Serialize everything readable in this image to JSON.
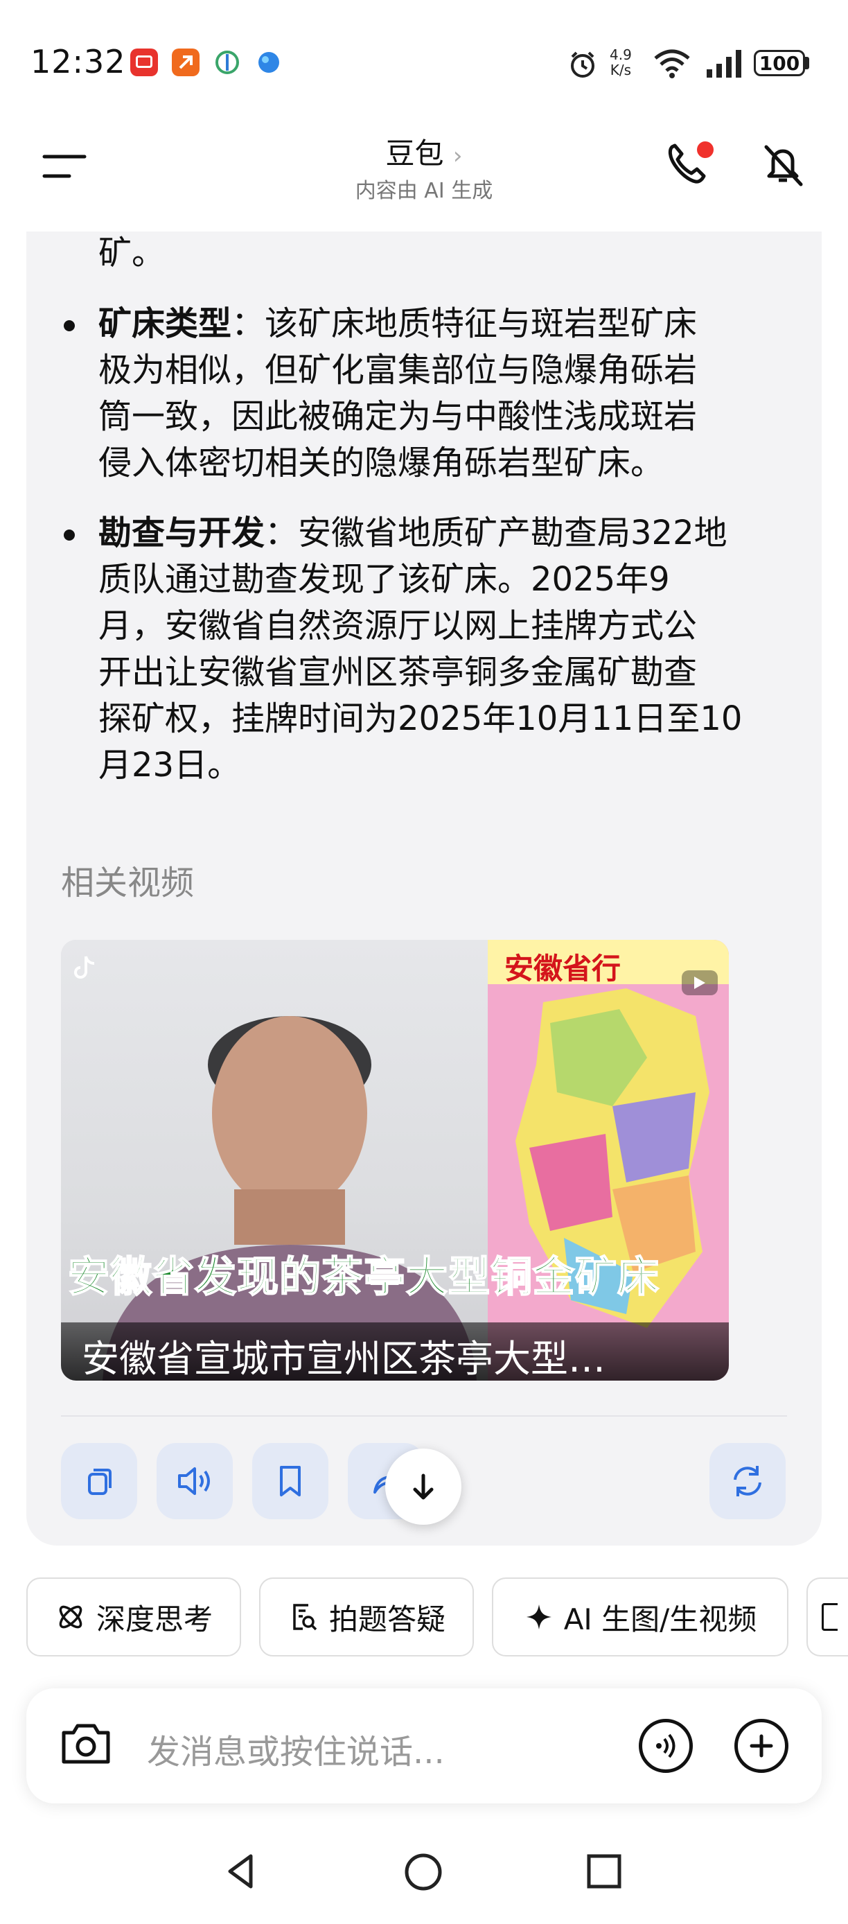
{
  "status_bar": {
    "time": "12:32",
    "net_speed_value": "4.9",
    "net_speed_unit": "K/s",
    "battery": "100",
    "icons": [
      "notification-app-icon-red",
      "notification-app-icon-orange",
      "notification-app-icon-green",
      "notification-app-icon-blue",
      "alarm-icon",
      "wifi-icon",
      "signal-icon",
      "battery-icon"
    ]
  },
  "header": {
    "title": "豆包",
    "subtitle": "内容由 AI 生成",
    "icons": [
      "menu-icon",
      "chevron-right-icon",
      "phone-icon",
      "mute-icon"
    ],
    "badge_color": "#f0312c"
  },
  "message": {
    "leading_fragment": "矿。",
    "bullets": [
      {
        "term": "矿床类型",
        "line1": "：该矿床地质特征与斑岩型矿床",
        "line2": "极为相似，但矿化富集部位与隐爆角砾岩",
        "line3": "筒一致，因此被确定为与中酸性浅成斑岩",
        "line4": "侵入体密切相关的隐爆角砾岩型矿床。"
      },
      {
        "term": "勘查与开发",
        "line1": "：安徽省地质矿产勘查局322地",
        "line2": "质队通过勘查发现了该矿床。2025年9",
        "line3": "月，安徽省自然资源厅以网上挂牌方式公",
        "line4": "开出让安徽省宣州区茶亭铜多金属矿勘查",
        "line5": "探矿权，挂牌时间为2025年10月11日至10",
        "line6": "月23日。"
      }
    ]
  },
  "related": {
    "title": "相关视频",
    "video": {
      "overlay_title": "安徽省发现的茶亭大型铜金矿床",
      "caption": "安徽省宣城市宣州区茶亭大型…",
      "map_header": "安徽省行",
      "icons": [
        "tiktok-icon",
        "play-icon"
      ]
    }
  },
  "actions": {
    "icons": [
      "copy-icon",
      "speaker-icon",
      "bookmark-icon",
      "share-icon",
      "scroll-down-icon",
      "regenerate-icon"
    ]
  },
  "chips": [
    {
      "label": "深度思考",
      "icon": "atom-icon"
    },
    {
      "label": "拍题答疑",
      "icon": "document-search-icon"
    },
    {
      "label": "AI 生图/生视频",
      "icon": "sparkle-icon"
    }
  ],
  "input": {
    "placeholder": "发消息或按住说话...",
    "icons": [
      "camera-icon",
      "voice-call-icon",
      "add-icon"
    ]
  },
  "nav": {
    "icons": [
      "back-icon",
      "home-icon",
      "recents-icon"
    ]
  },
  "colors": {
    "accent": "#2f6fe0",
    "action_bg": "#e3e9f6",
    "card_bg": "#f3f3f5"
  }
}
